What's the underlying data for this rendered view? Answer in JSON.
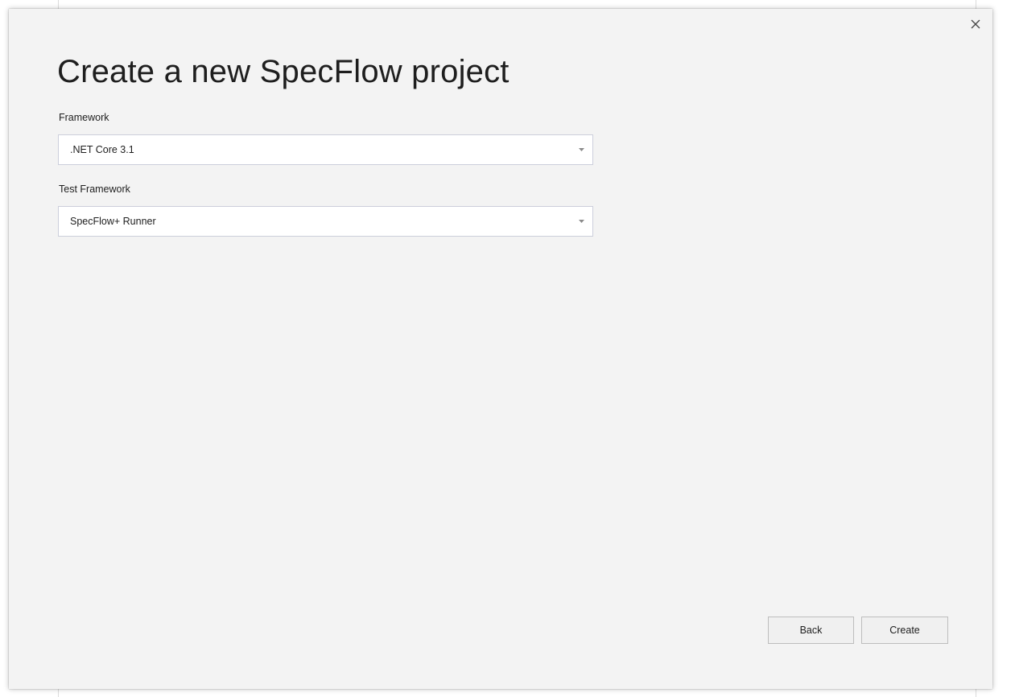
{
  "dialog": {
    "title": "Create a new SpecFlow project",
    "close_icon": "close-icon"
  },
  "framework": {
    "label": "Framework",
    "selected": ".NET Core 3.1",
    "icon": "chevron-down-icon"
  },
  "test_framework": {
    "label": "Test Framework",
    "selected": "SpecFlow+ Runner",
    "icon": "chevron-down-icon"
  },
  "footer": {
    "back_label": "Back",
    "create_label": "Create"
  },
  "colors": {
    "dialog_bg": "#f3f3f3",
    "field_bg": "#ffffff",
    "field_border": "#cccedb",
    "text": "#1e1e1e"
  }
}
